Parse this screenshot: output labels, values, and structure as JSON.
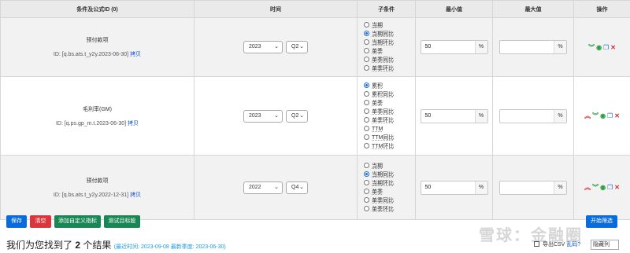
{
  "headers": [
    "条件及公式ID (0)",
    "时间",
    "子条件",
    "最小值",
    "最大值",
    "操作"
  ],
  "rows": [
    {
      "name": "预付款项",
      "id_prefix": "ID: [q.bs.ats.t_y2y.2023-06-30]",
      "copy_label": "拷贝",
      "year": "2023",
      "quarter": "Q2",
      "options": [
        "当期",
        "当期同比",
        "当期环比",
        "单季",
        "单季同比",
        "单季环比"
      ],
      "selected": 1,
      "min": "50",
      "max": "",
      "pct": "%",
      "first_icon": "double-chevron-down-icon"
    },
    {
      "name": "毛利率(GM)",
      "id_prefix": "ID: [q.ps.gp_m.t.2023-06-30]",
      "copy_label": "拷贝",
      "year": "2023",
      "quarter": "Q2",
      "options": [
        "累积",
        "累积同比",
        "单季",
        "单季同比",
        "单季环比",
        "TTM",
        "TTM同比",
        "TTM环比"
      ],
      "selected": 0,
      "min": "50",
      "max": "",
      "pct": "%",
      "first_icon": "double-chevron-up-icon"
    },
    {
      "name": "预付款项",
      "id_prefix": "ID: [q.bs.ats.t_y2y.2022-12-31]",
      "copy_label": "拷贝",
      "year": "2022",
      "quarter": "Q4",
      "options": [
        "当期",
        "当期同比",
        "当期环比",
        "单季",
        "单季同比",
        "单季环比"
      ],
      "selected": 1,
      "min": "50",
      "max": "",
      "pct": "%",
      "first_icon": "double-chevron-up-icon"
    }
  ],
  "buttons": {
    "save": "保存",
    "clear": "清空",
    "add_custom": "添加自定义指标",
    "test_stock": "测试目标股",
    "start": "开始筛选"
  },
  "results": {
    "prefix": "我们为您找到了",
    "count": "2",
    "suffix": "个结果",
    "meta": "(最近时间: 2023-09-08 最新季度: 2023-06-30)"
  },
  "watermark": "雪球：金融圈",
  "export": {
    "label": "导出CSV",
    "help": "乱码?",
    "column_select": "隐藏列"
  },
  "colors": {
    "primary": "#0a6cdb",
    "danger": "#d9363e",
    "success": "#198754",
    "link": "#1a55cc"
  }
}
